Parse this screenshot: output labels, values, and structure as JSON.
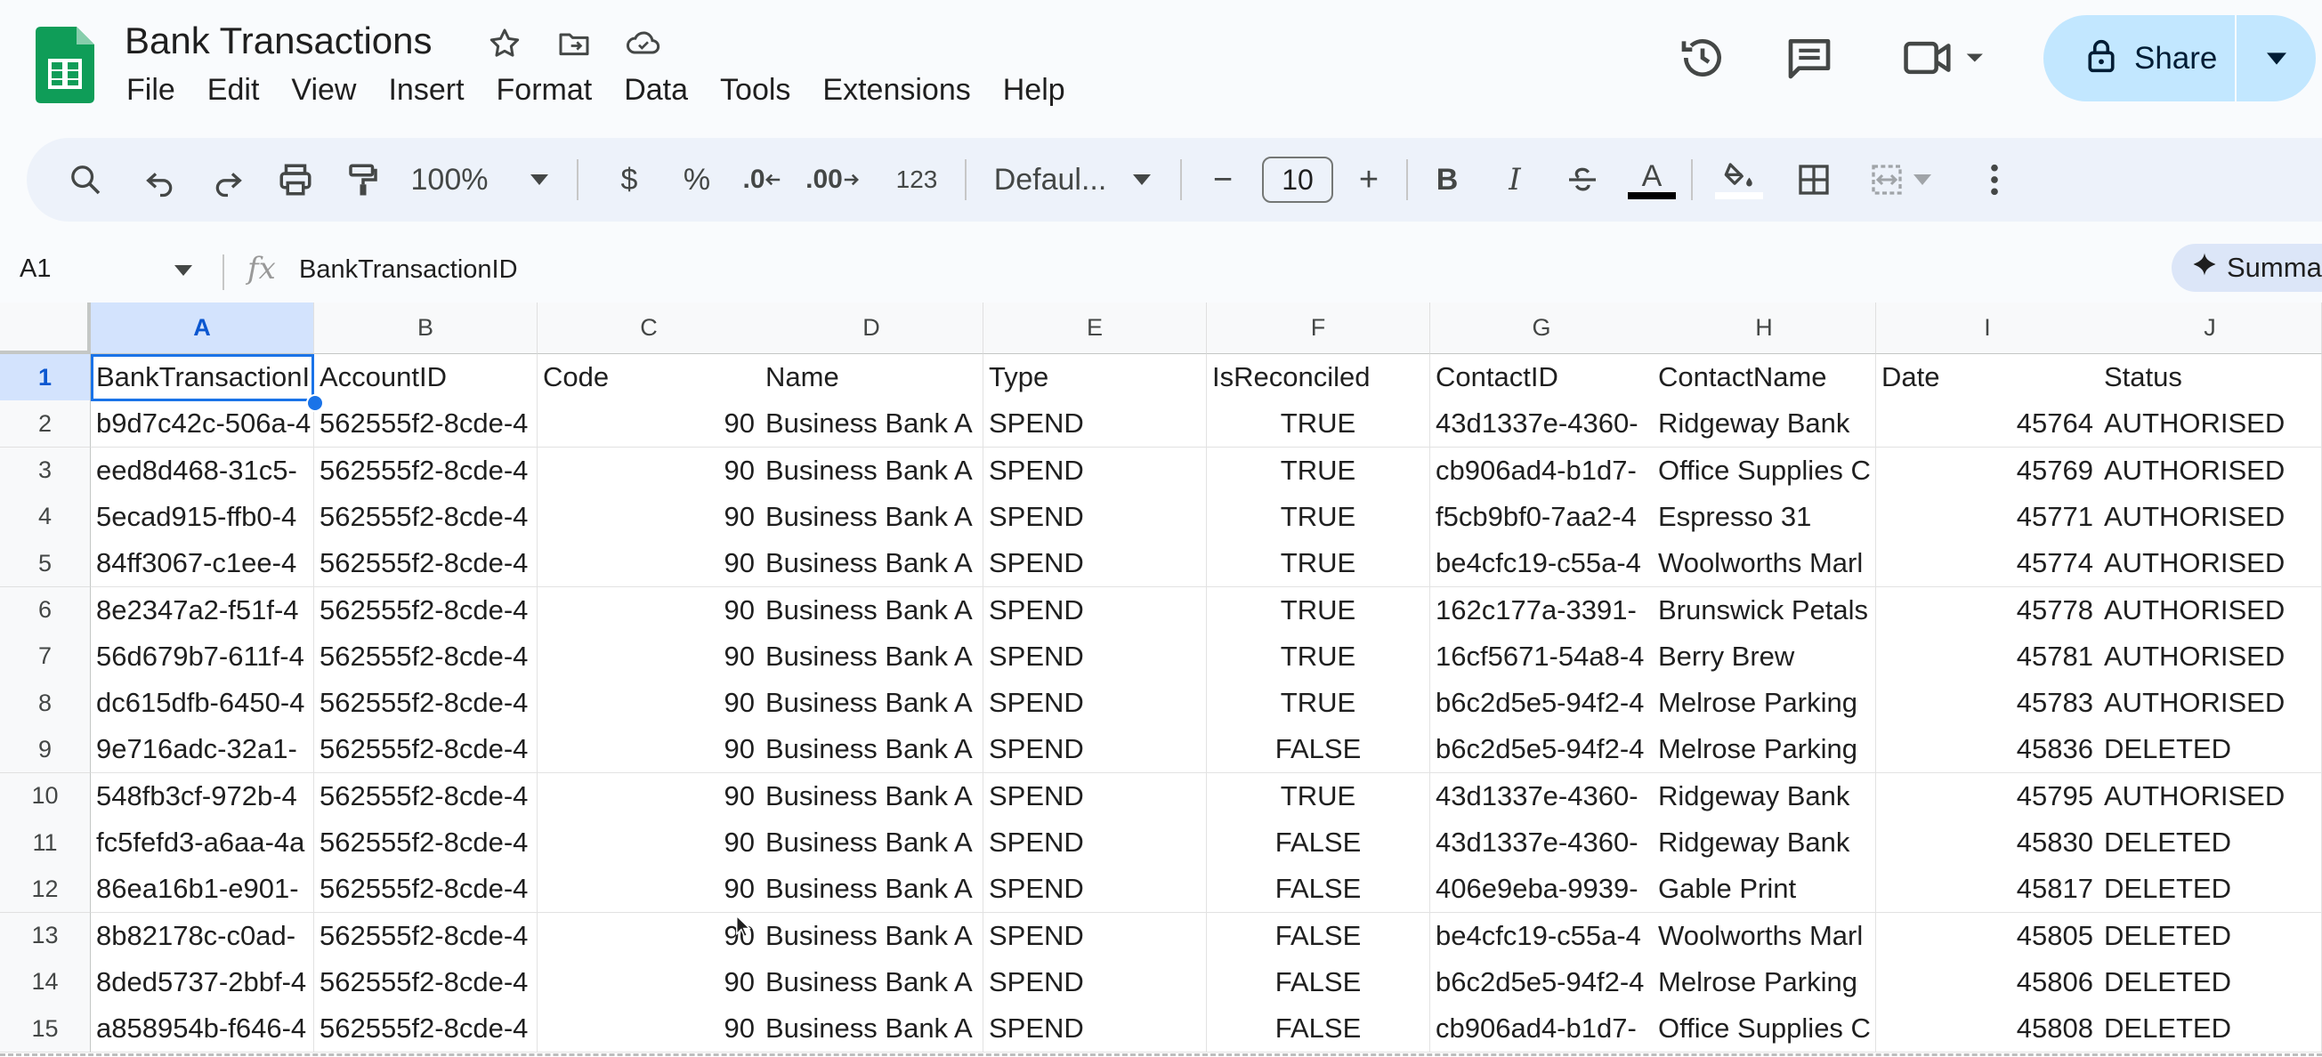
{
  "app": {
    "title": "Bank Transactions",
    "menu": [
      "File",
      "Edit",
      "View",
      "Insert",
      "Format",
      "Data",
      "Tools",
      "Extensions",
      "Help"
    ],
    "share_label": "Share",
    "colors": {
      "accent": "#1a73e8",
      "share_bg": "#c2e7ff",
      "selected_header": "#d3e3fd",
      "logo_green": "#0f9d58"
    }
  },
  "toolbar": {
    "zoom": "100%",
    "currency": "$",
    "percent": "%",
    "decrease_decimal": ".0",
    "increase_decimal": ".00",
    "more_formats": "123",
    "font": "Defaul...",
    "font_size": "10",
    "minus": "−",
    "plus": "+",
    "bold": "B",
    "italic": "I",
    "text_color_letter": "A"
  },
  "formula_bar": {
    "cell_ref": "A1",
    "fx": "fx",
    "content": "BankTransactionID",
    "summarize_label": "Summa"
  },
  "grid": {
    "columns": [
      "A",
      "B",
      "C",
      "D",
      "E",
      "F",
      "G",
      "H",
      "I",
      "J"
    ],
    "selected_column": "A",
    "selected_row": 1,
    "headers": [
      "BankTransactionID",
      "AccountID",
      "Code",
      "Name",
      "Type",
      "IsReconciled",
      "ContactID",
      "ContactName",
      "Date",
      "Status"
    ],
    "rows": [
      {
        "num": "2",
        "cells": [
          "b9d7c42c-506a-4",
          "562555f2-8cde-4",
          "90",
          "Business Bank A",
          "SPEND",
          "TRUE",
          "43d1337e-4360-",
          "Ridgeway Bank",
          "45764",
          "AUTHORISED"
        ]
      },
      {
        "num": "3",
        "cells": [
          "eed8d468-31c5-",
          "562555f2-8cde-4",
          "90",
          "Business Bank A",
          "SPEND",
          "TRUE",
          "cb906ad4-b1d7-",
          "Office Supplies C",
          "45769",
          "AUTHORISED"
        ]
      },
      {
        "num": "4",
        "cells": [
          "5ecad915-ffb0-4",
          "562555f2-8cde-4",
          "90",
          "Business Bank A",
          "SPEND",
          "TRUE",
          "f5cb9bf0-7aa2-4",
          "Espresso 31",
          "45771",
          "AUTHORISED"
        ]
      },
      {
        "num": "5",
        "cells": [
          "84ff3067-c1ee-4",
          "562555f2-8cde-4",
          "90",
          "Business Bank A",
          "SPEND",
          "TRUE",
          "be4cfc19-c55a-4",
          "Woolworths Marl",
          "45774",
          "AUTHORISED"
        ]
      },
      {
        "num": "6",
        "cells": [
          "8e2347a2-f51f-4",
          "562555f2-8cde-4",
          "90",
          "Business Bank A",
          "SPEND",
          "TRUE",
          "162c177a-3391-",
          "Brunswick Petals",
          "45778",
          "AUTHORISED"
        ]
      },
      {
        "num": "7",
        "cells": [
          "56d679b7-611f-4",
          "562555f2-8cde-4",
          "90",
          "Business Bank A",
          "SPEND",
          "TRUE",
          "16cf5671-54a8-4",
          "Berry Brew",
          "45781",
          "AUTHORISED"
        ]
      },
      {
        "num": "8",
        "cells": [
          "dc615dfb-6450-4",
          "562555f2-8cde-4",
          "90",
          "Business Bank A",
          "SPEND",
          "TRUE",
          "b6c2d5e5-94f2-4",
          "Melrose Parking",
          "45783",
          "AUTHORISED"
        ]
      },
      {
        "num": "9",
        "cells": [
          "9e716adc-32a1-",
          "562555f2-8cde-4",
          "90",
          "Business Bank A",
          "SPEND",
          "FALSE",
          "b6c2d5e5-94f2-4",
          "Melrose Parking",
          "45836",
          "DELETED"
        ]
      },
      {
        "num": "10",
        "cells": [
          "548fb3cf-972b-4",
          "562555f2-8cde-4",
          "90",
          "Business Bank A",
          "SPEND",
          "TRUE",
          "43d1337e-4360-",
          "Ridgeway Bank",
          "45795",
          "AUTHORISED"
        ]
      },
      {
        "num": "11",
        "cells": [
          "fc5fefd3-a6aa-4a",
          "562555f2-8cde-4",
          "90",
          "Business Bank A",
          "SPEND",
          "FALSE",
          "43d1337e-4360-",
          "Ridgeway Bank",
          "45830",
          "DELETED"
        ]
      },
      {
        "num": "12",
        "cells": [
          "86ea16b1-e901-",
          "562555f2-8cde-4",
          "90",
          "Business Bank A",
          "SPEND",
          "FALSE",
          "406e9eba-9939-",
          "Gable Print",
          "45817",
          "DELETED"
        ]
      },
      {
        "num": "13",
        "cells": [
          "8b82178c-c0ad-",
          "562555f2-8cde-4",
          "90",
          "Business Bank A",
          "SPEND",
          "FALSE",
          "be4cfc19-c55a-4",
          "Woolworths Marl",
          "45805",
          "DELETED"
        ]
      },
      {
        "num": "14",
        "cells": [
          "8ded5737-2bbf-4",
          "562555f2-8cde-4",
          "90",
          "Business Bank A",
          "SPEND",
          "FALSE",
          "b6c2d5e5-94f2-4",
          "Melrose Parking",
          "45806",
          "DELETED"
        ]
      },
      {
        "num": "15",
        "cells": [
          "a858954b-f646-4",
          "562555f2-8cde-4",
          "90",
          "Business Bank A",
          "SPEND",
          "FALSE",
          "cb906ad4-b1d7-",
          "Office Supplies C",
          "45808",
          "DELETED"
        ]
      }
    ]
  }
}
